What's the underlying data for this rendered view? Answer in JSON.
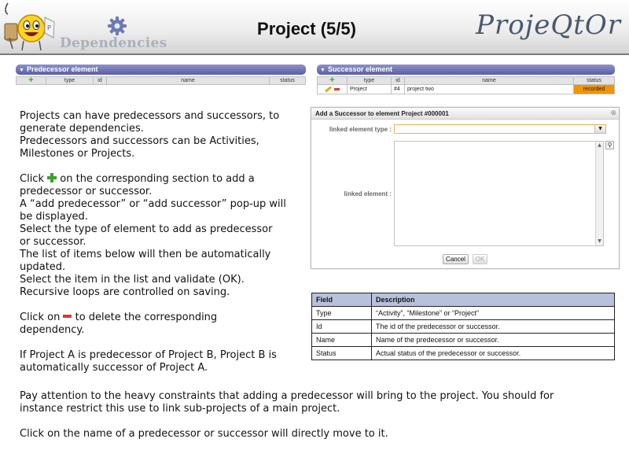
{
  "header": {
    "section": "Dependencies",
    "title": "Project (5/5)",
    "brand": "ProjeQtOr",
    "gear_icon": "gear-icon",
    "mascot_icon": "smiley-mascot-icon"
  },
  "predecessor_panel": {
    "title": "Predecessor element",
    "add_icon": "plus-icon",
    "columns": [
      "type",
      "id",
      "name",
      "status"
    ]
  },
  "successor_panel": {
    "title": "Successor element",
    "add_icon": "plus-icon",
    "columns": [
      "type",
      "id",
      "name",
      "status"
    ],
    "rows": [
      {
        "type": "Project",
        "id": "#4",
        "name": "project two",
        "status": "recorded",
        "edit_icon": "pencil-icon",
        "delete_icon": "minus-icon"
      }
    ],
    "status_color": "#f39300"
  },
  "text": {
    "p1": [
      "Projects can have predecessors and successors, to",
      "generate dependencies.",
      "Predecessors and successors can be Activities,",
      "Milestones or Projects."
    ],
    "p2_click": "Click",
    "p2_rest": "on the corresponding section to add a",
    "p2": [
      "predecessor or successor.",
      "A “add predecessor” or “add successor” pop-up will",
      "be displayed.",
      "Select the type of element to add as predecessor",
      "or successor.",
      "The list of items below will then be automatically",
      "updated.",
      "Select the item in the list and validate (OK).",
      "Recursive loops are controlled on saving."
    ],
    "p3_click": "Click on",
    "p3_rest": "to delete the corresponding",
    "p3": [
      "dependency."
    ],
    "p4": [
      "If Project A is predecessor of Project B, Project B is",
      "automatically successor of Project A."
    ],
    "p5": [
      "Pay attention to the heavy constraints that adding a predecessor will bring to the project. You should for",
      "instance restrict this use to link sub-projects of a main project."
    ],
    "p6": [
      "Click on the name of a predecessor or successor will directly move to it."
    ]
  },
  "dialog": {
    "title": "Add a Successor to element Project #000001",
    "close": "⊗",
    "type_label": "linked element type :",
    "type_value": "",
    "element_label": "linked element :",
    "cancel": "Cancel",
    "ok": "OK",
    "search_icon": "magnifier-icon"
  },
  "field_table": {
    "headers": [
      "Field",
      "Description"
    ],
    "rows": [
      [
        "Type",
        "“Activity”, “Milestone” or “Project”"
      ],
      [
        "Id",
        "The id of the predecessor or successor."
      ],
      [
        "Name",
        "Name of the predecessor or successor."
      ],
      [
        "Status",
        "Actual status of the predecessor or successor."
      ]
    ]
  }
}
